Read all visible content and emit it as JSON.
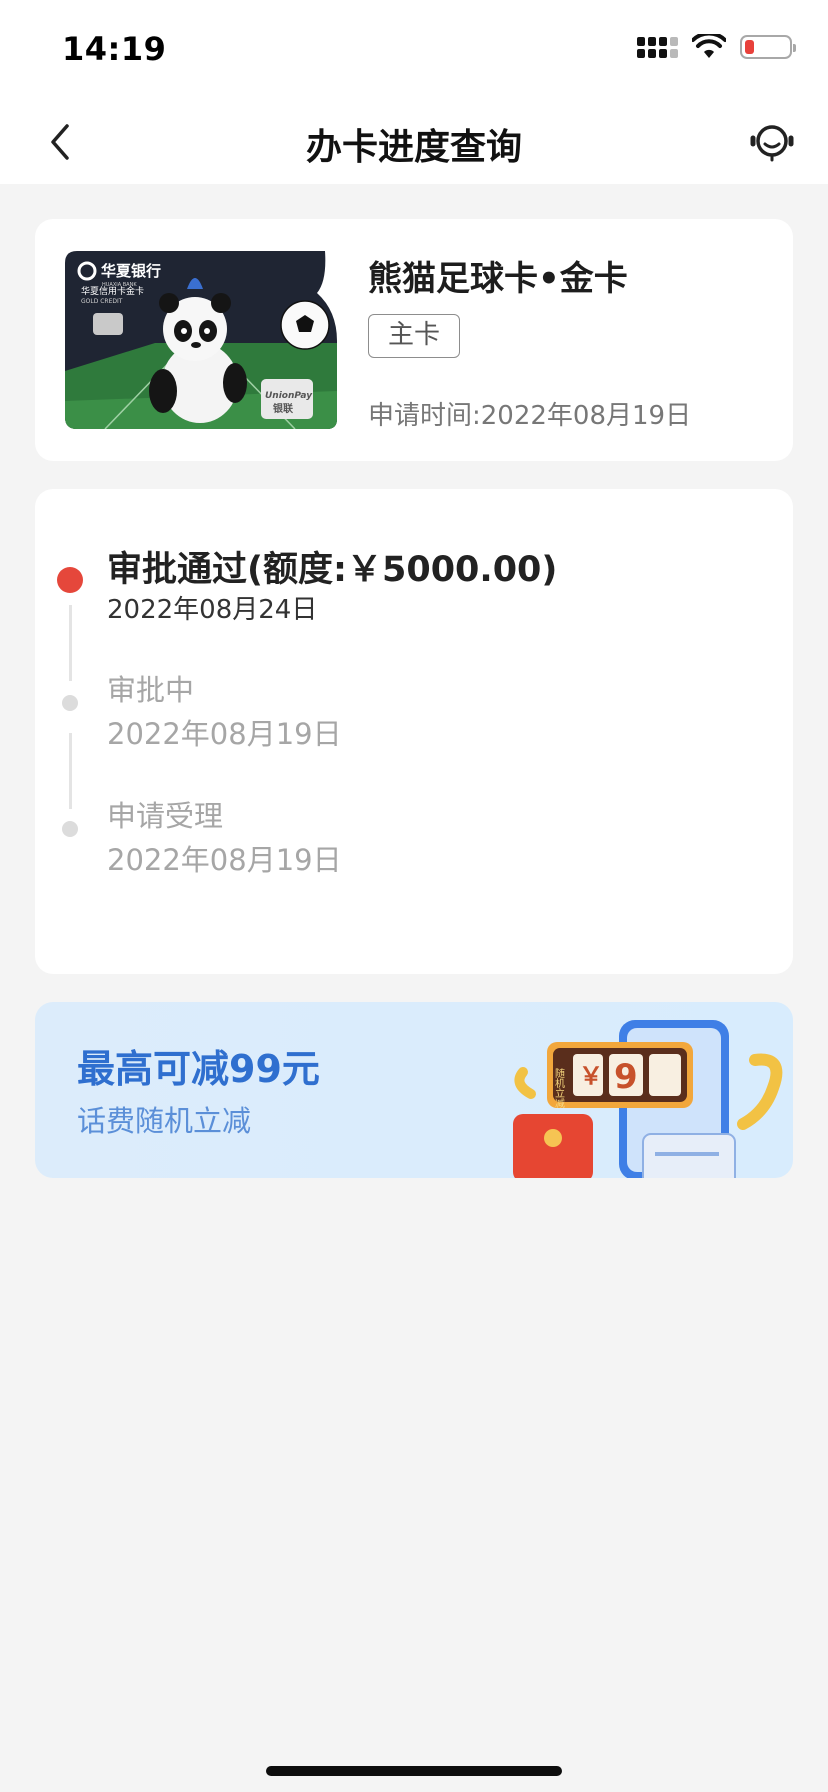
{
  "status_bar": {
    "time": "14:19",
    "battery_level": 0.2
  },
  "nav": {
    "title": "办卡进度查询",
    "back_icon": "chevron-left-icon",
    "service_icon": "customer-service-icon"
  },
  "card_info": {
    "bank_name": "华夏银行",
    "bank_name_en": "HUAXIA BANK",
    "card_series": "华夏信用卡金卡",
    "card_grade_en": "GOLD CREDIT",
    "network_logo": "UnionPay",
    "network_logo_cn": "银联",
    "card_name": "熊猫足球卡•金卡",
    "tag": "主卡",
    "apply_date": "申请时间:2022年08月19日"
  },
  "progress": {
    "steps": [
      {
        "title": "审批通过(额度:￥5000.00)",
        "date": "2022年08月24日",
        "active": true
      },
      {
        "title": "审批中",
        "date": "2022年08月19日",
        "active": false
      },
      {
        "title": "申请受理",
        "date": "2022年08月19日",
        "active": false
      }
    ]
  },
  "banner": {
    "title": "最高可减99元",
    "subtitle": "话费随机立减",
    "slot_label": "随机立减",
    "slot_chars": [
      "￥",
      "9"
    ]
  },
  "colors": {
    "accent_red": "#e5473b",
    "banner_blue": "#2f6fcf",
    "banner_bg": "#dcecfb"
  }
}
